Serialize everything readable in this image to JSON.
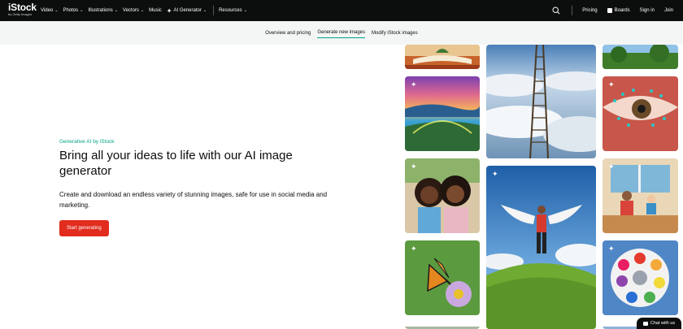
{
  "header": {
    "logo": {
      "brand": "iStock",
      "sub": "by Getty Images"
    },
    "nav": [
      {
        "label": "Video",
        "has_menu": true
      },
      {
        "label": "Photos",
        "has_menu": true
      },
      {
        "label": "Illustrations",
        "has_menu": true
      },
      {
        "label": "Vectors",
        "has_menu": true
      },
      {
        "label": "Music",
        "has_menu": false
      }
    ],
    "ai_generator": "AI Generator",
    "resources": "Resources",
    "pricing": "Pricing",
    "boards": "Boards",
    "sign_in": "Sign in",
    "join": "Join"
  },
  "subnav": {
    "tabs": [
      "Overview and pricing",
      "Generate new images",
      "Modify iStock images"
    ],
    "active_index": 1
  },
  "hero": {
    "eyebrow": "Generative AI by iStock",
    "headline": "Bring all your ideas to life with our AI image generator",
    "description": "Create and download an endless variety of stunning images, safe for use in social media and marketing.",
    "cta": "Start generating"
  },
  "chat": {
    "label": "Chat with us"
  },
  "colors": {
    "accent": "#02a388",
    "cta": "#e12c1e",
    "topbar": "#0c0d0d",
    "subnav": "#f4f5f5"
  }
}
